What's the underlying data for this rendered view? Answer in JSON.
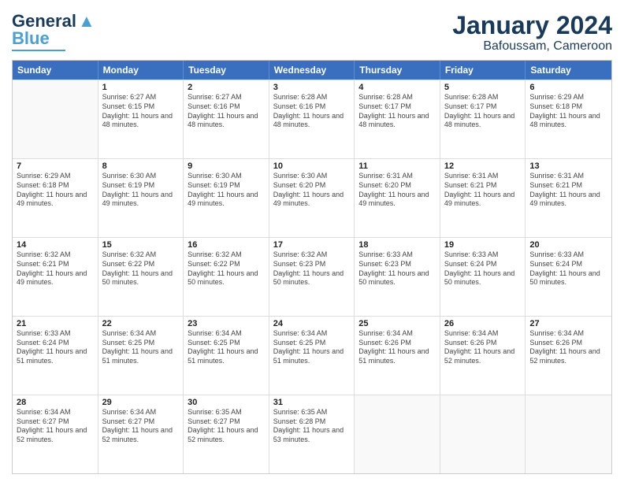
{
  "logo": {
    "line1": "General",
    "line2": "Blue"
  },
  "title": "January 2024",
  "location": "Bafoussam, Cameroon",
  "header": {
    "days": [
      "Sunday",
      "Monday",
      "Tuesday",
      "Wednesday",
      "Thursday",
      "Friday",
      "Saturday"
    ]
  },
  "weeks": [
    [
      {
        "day": "",
        "empty": true
      },
      {
        "day": "1",
        "sunrise": "Sunrise: 6:27 AM",
        "sunset": "Sunset: 6:15 PM",
        "daylight": "Daylight: 11 hours and 48 minutes."
      },
      {
        "day": "2",
        "sunrise": "Sunrise: 6:27 AM",
        "sunset": "Sunset: 6:16 PM",
        "daylight": "Daylight: 11 hours and 48 minutes."
      },
      {
        "day": "3",
        "sunrise": "Sunrise: 6:28 AM",
        "sunset": "Sunset: 6:16 PM",
        "daylight": "Daylight: 11 hours and 48 minutes."
      },
      {
        "day": "4",
        "sunrise": "Sunrise: 6:28 AM",
        "sunset": "Sunset: 6:17 PM",
        "daylight": "Daylight: 11 hours and 48 minutes."
      },
      {
        "day": "5",
        "sunrise": "Sunrise: 6:28 AM",
        "sunset": "Sunset: 6:17 PM",
        "daylight": "Daylight: 11 hours and 48 minutes."
      },
      {
        "day": "6",
        "sunrise": "Sunrise: 6:29 AM",
        "sunset": "Sunset: 6:18 PM",
        "daylight": "Daylight: 11 hours and 48 minutes."
      }
    ],
    [
      {
        "day": "7",
        "sunrise": "Sunrise: 6:29 AM",
        "sunset": "Sunset: 6:18 PM",
        "daylight": "Daylight: 11 hours and 49 minutes."
      },
      {
        "day": "8",
        "sunrise": "Sunrise: 6:30 AM",
        "sunset": "Sunset: 6:19 PM",
        "daylight": "Daylight: 11 hours and 49 minutes."
      },
      {
        "day": "9",
        "sunrise": "Sunrise: 6:30 AM",
        "sunset": "Sunset: 6:19 PM",
        "daylight": "Daylight: 11 hours and 49 minutes."
      },
      {
        "day": "10",
        "sunrise": "Sunrise: 6:30 AM",
        "sunset": "Sunset: 6:20 PM",
        "daylight": "Daylight: 11 hours and 49 minutes."
      },
      {
        "day": "11",
        "sunrise": "Sunrise: 6:31 AM",
        "sunset": "Sunset: 6:20 PM",
        "daylight": "Daylight: 11 hours and 49 minutes."
      },
      {
        "day": "12",
        "sunrise": "Sunrise: 6:31 AM",
        "sunset": "Sunset: 6:21 PM",
        "daylight": "Daylight: 11 hours and 49 minutes."
      },
      {
        "day": "13",
        "sunrise": "Sunrise: 6:31 AM",
        "sunset": "Sunset: 6:21 PM",
        "daylight": "Daylight: 11 hours and 49 minutes."
      }
    ],
    [
      {
        "day": "14",
        "sunrise": "Sunrise: 6:32 AM",
        "sunset": "Sunset: 6:21 PM",
        "daylight": "Daylight: 11 hours and 49 minutes."
      },
      {
        "day": "15",
        "sunrise": "Sunrise: 6:32 AM",
        "sunset": "Sunset: 6:22 PM",
        "daylight": "Daylight: 11 hours and 50 minutes."
      },
      {
        "day": "16",
        "sunrise": "Sunrise: 6:32 AM",
        "sunset": "Sunset: 6:22 PM",
        "daylight": "Daylight: 11 hours and 50 minutes."
      },
      {
        "day": "17",
        "sunrise": "Sunrise: 6:32 AM",
        "sunset": "Sunset: 6:23 PM",
        "daylight": "Daylight: 11 hours and 50 minutes."
      },
      {
        "day": "18",
        "sunrise": "Sunrise: 6:33 AM",
        "sunset": "Sunset: 6:23 PM",
        "daylight": "Daylight: 11 hours and 50 minutes."
      },
      {
        "day": "19",
        "sunrise": "Sunrise: 6:33 AM",
        "sunset": "Sunset: 6:24 PM",
        "daylight": "Daylight: 11 hours and 50 minutes."
      },
      {
        "day": "20",
        "sunrise": "Sunrise: 6:33 AM",
        "sunset": "Sunset: 6:24 PM",
        "daylight": "Daylight: 11 hours and 50 minutes."
      }
    ],
    [
      {
        "day": "21",
        "sunrise": "Sunrise: 6:33 AM",
        "sunset": "Sunset: 6:24 PM",
        "daylight": "Daylight: 11 hours and 51 minutes."
      },
      {
        "day": "22",
        "sunrise": "Sunrise: 6:34 AM",
        "sunset": "Sunset: 6:25 PM",
        "daylight": "Daylight: 11 hours and 51 minutes."
      },
      {
        "day": "23",
        "sunrise": "Sunrise: 6:34 AM",
        "sunset": "Sunset: 6:25 PM",
        "daylight": "Daylight: 11 hours and 51 minutes."
      },
      {
        "day": "24",
        "sunrise": "Sunrise: 6:34 AM",
        "sunset": "Sunset: 6:25 PM",
        "daylight": "Daylight: 11 hours and 51 minutes."
      },
      {
        "day": "25",
        "sunrise": "Sunrise: 6:34 AM",
        "sunset": "Sunset: 6:26 PM",
        "daylight": "Daylight: 11 hours and 51 minutes."
      },
      {
        "day": "26",
        "sunrise": "Sunrise: 6:34 AM",
        "sunset": "Sunset: 6:26 PM",
        "daylight": "Daylight: 11 hours and 52 minutes."
      },
      {
        "day": "27",
        "sunrise": "Sunrise: 6:34 AM",
        "sunset": "Sunset: 6:26 PM",
        "daylight": "Daylight: 11 hours and 52 minutes."
      }
    ],
    [
      {
        "day": "28",
        "sunrise": "Sunrise: 6:34 AM",
        "sunset": "Sunset: 6:27 PM",
        "daylight": "Daylight: 11 hours and 52 minutes."
      },
      {
        "day": "29",
        "sunrise": "Sunrise: 6:34 AM",
        "sunset": "Sunset: 6:27 PM",
        "daylight": "Daylight: 11 hours and 52 minutes."
      },
      {
        "day": "30",
        "sunrise": "Sunrise: 6:35 AM",
        "sunset": "Sunset: 6:27 PM",
        "daylight": "Daylight: 11 hours and 52 minutes."
      },
      {
        "day": "31",
        "sunrise": "Sunrise: 6:35 AM",
        "sunset": "Sunset: 6:28 PM",
        "daylight": "Daylight: 11 hours and 53 minutes."
      },
      {
        "day": "",
        "empty": true
      },
      {
        "day": "",
        "empty": true
      },
      {
        "day": "",
        "empty": true
      }
    ]
  ]
}
